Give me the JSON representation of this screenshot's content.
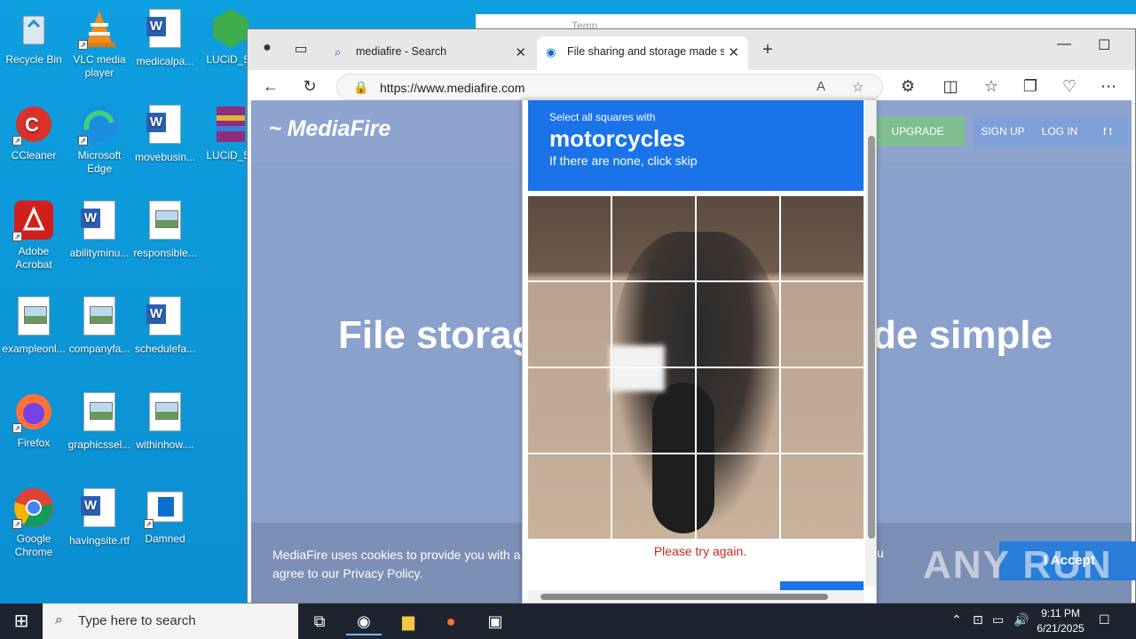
{
  "desktop": {
    "icons": [
      {
        "label": "Recycle Bin"
      },
      {
        "label": "VLC media player"
      },
      {
        "label": "medicalpa..."
      },
      {
        "label": "LUCiD_5e"
      },
      {
        "label": "CCleaner"
      },
      {
        "label": "Microsoft Edge"
      },
      {
        "label": "movebusin..."
      },
      {
        "label": "LUCiD_5e"
      },
      {
        "label": "Adobe Acrobat"
      },
      {
        "label": "abilityminu..."
      },
      {
        "label": "responsible..."
      },
      {
        "label": "exampleonl..."
      },
      {
        "label": "companyfa..."
      },
      {
        "label": "schedulefa..."
      },
      {
        "label": "Firefox"
      },
      {
        "label": "graphicssel..."
      },
      {
        "label": "withinhow...."
      },
      {
        "label": "Google Chrome"
      },
      {
        "label": "havingsite.rtf"
      },
      {
        "label": "Damned"
      }
    ]
  },
  "explorer": {
    "title": "Temp"
  },
  "browser": {
    "tabs": [
      {
        "label": "mediafire - Search"
      },
      {
        "label": "File sharing and storage made sin"
      }
    ],
    "url": "https://www.mediafire.com"
  },
  "mediafire": {
    "logo": "MediaFire",
    "upgrade": "UPGRADE",
    "signup": "SIGN UP",
    "login": "LOG IN",
    "hero_left": "File storag",
    "hero_right": "de simple",
    "cookie_text": "MediaFire uses cookies to provide you with a p agree to our Privacy Policy.",
    "cookie_tail": "u",
    "accept": "I Accept"
  },
  "captcha": {
    "line1": "Select all squares with",
    "line2": "motorcycles",
    "line3": "If there are none, click skip",
    "error": "Please try again."
  },
  "watermark": "ANY RUN",
  "taskbar": {
    "search_placeholder": "Type here to search",
    "time": "9:11 PM",
    "date": "6/21/2025"
  },
  "colors": {
    "desktop": "#0e9fe0",
    "captcha_blue": "#1a73e8",
    "mediafire_overlay": "#8aa1cc"
  }
}
